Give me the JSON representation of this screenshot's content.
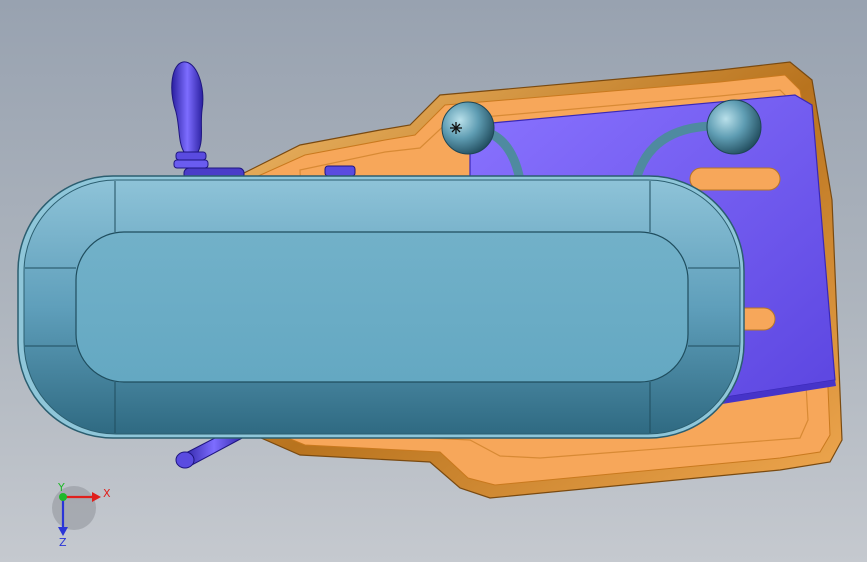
{
  "view": {
    "background_top": "#98a2b0",
    "background_bottom": "#c5c9cf"
  },
  "model": {
    "plate_color": "#f7a75a",
    "plate_rim_color": "#c9791e",
    "slide_color": "#7a63f0",
    "cover_color": "#6ba9c4",
    "handle_color": "#5a4be0",
    "knob_color": "#5c97ad"
  },
  "triad": {
    "x_label": "X",
    "y_label": "Y",
    "z_label": "Z",
    "x_color": "#e0201c",
    "y_color": "#1fb829",
    "z_color": "#2a35d8"
  }
}
